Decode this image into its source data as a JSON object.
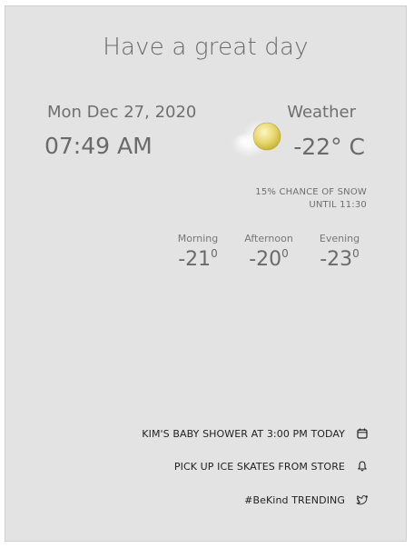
{
  "greeting": "Have a great day",
  "date": "Mon Dec 27, 2020",
  "time": "07:49 AM",
  "weather": {
    "label": "Weather",
    "icon": "partly-cloudy-sun-icon",
    "temperature": "-22° C",
    "snow_line1": "15% CHANCE OF SNOW",
    "snow_line2": "UNTIL 11:30"
  },
  "forecast": [
    {
      "label": "Morning",
      "value": "-21",
      "unit": "0"
    },
    {
      "label": "Afternoon",
      "value": "-20",
      "unit": "0"
    },
    {
      "label": "Evening",
      "value": "-23",
      "unit": "0"
    }
  ],
  "events": [
    {
      "text": "KIM'S BABY SHOWER AT 3:00 PM TODAY",
      "icon": "calendar-icon"
    },
    {
      "text": "PICK UP ICE SKATES FROM STORE",
      "icon": "bell-icon"
    },
    {
      "text": "#BeKind TRENDING",
      "icon": "twitter-icon"
    }
  ]
}
